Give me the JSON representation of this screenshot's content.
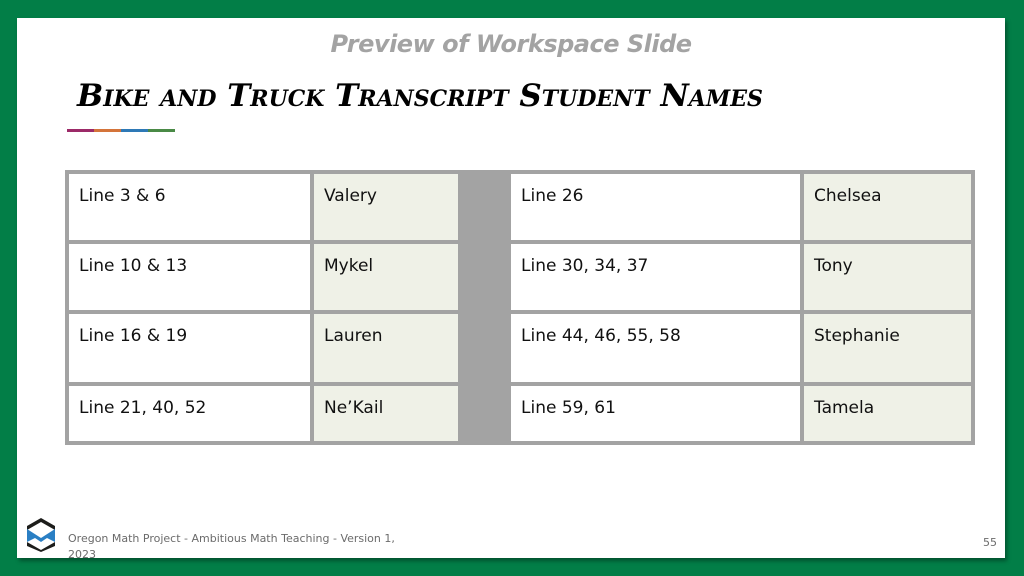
{
  "header": {
    "preview_title": "Preview of Workspace Slide",
    "title": "Bike and Truck Transcript Student Names"
  },
  "accent_colors": [
    "#9c2a68",
    "#d4743a",
    "#2e79b6",
    "#4a8a46"
  ],
  "table": {
    "left": [
      {
        "lines": "Line 3 & 6",
        "name": "Valery"
      },
      {
        "lines": "Line 10 & 13",
        "name": "Mykel"
      },
      {
        "lines": "Line 16 & 19",
        "name": "Lauren"
      },
      {
        "lines": "Line 21, 40, 52",
        "name": "Ne’Kail"
      }
    ],
    "right": [
      {
        "lines": "Line 26",
        "name": "Chelsea"
      },
      {
        "lines": "Line 30, 34, 37",
        "name": "Tony"
      },
      {
        "lines": "Line 44, 46, 55, 58",
        "name": "Stephanie"
      },
      {
        "lines": "Line 59, 61",
        "name": "Tamela"
      }
    ]
  },
  "footer": {
    "logo_icon": "oregon-math-project-logo",
    "text": "Oregon Math Project - Ambitious Math Teaching - Version 1, 2023",
    "page_number": "55"
  }
}
